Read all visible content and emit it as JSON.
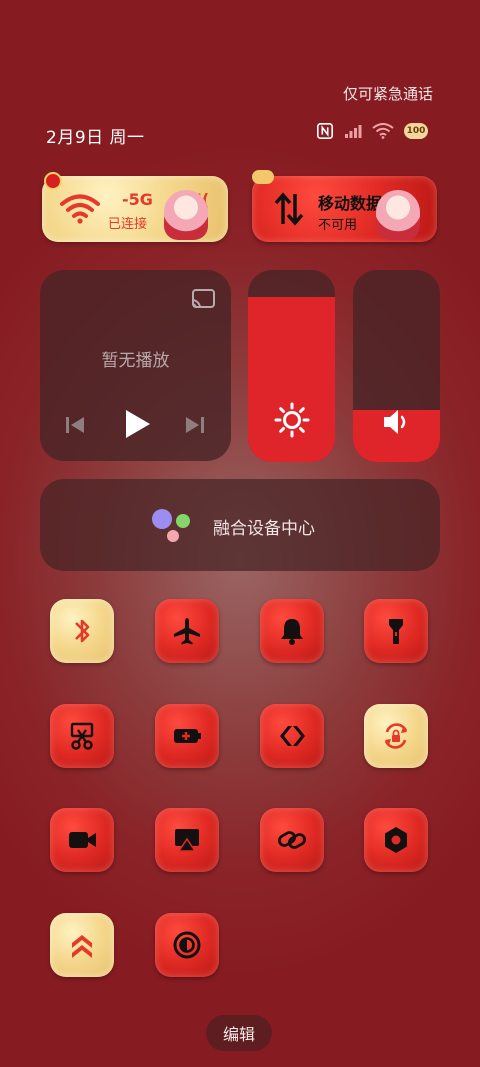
{
  "status": {
    "emergency_text": "仅可紧急通话",
    "date_text": "2月9日 周一",
    "battery": "100"
  },
  "wifi_card": {
    "title": "-5G",
    "extra": "MI(",
    "status": "已连接"
  },
  "data_card": {
    "title": "移动数据",
    "status": "不可用"
  },
  "media": {
    "status": "暂无播放"
  },
  "sliders": {
    "brightness_level": 0.86,
    "volume_level": 0.27
  },
  "device_center": {
    "label": "融合设备中心"
  },
  "toggles": [
    {
      "icon": "bluetooth-icon",
      "active": true
    },
    {
      "icon": "airplane-icon",
      "active": false
    },
    {
      "icon": "bell-icon",
      "active": false
    },
    {
      "icon": "flashlight-icon",
      "active": false
    },
    {
      "icon": "screenshot-scissors-icon",
      "active": false
    },
    {
      "icon": "battery-saver-icon",
      "active": false
    },
    {
      "icon": "share-arrow-icon",
      "active": false
    },
    {
      "icon": "rotation-lock-icon",
      "active": true
    },
    {
      "icon": "screen-record-icon",
      "active": false
    },
    {
      "icon": "cast-screen-icon",
      "active": false
    },
    {
      "icon": "link-icon",
      "active": false
    },
    {
      "icon": "hexagon-nut-icon",
      "active": false
    },
    {
      "icon": "performance-chevrons-icon",
      "active": true
    },
    {
      "icon": "dark-mode-icon",
      "active": false
    }
  ],
  "edit_label": "编辑",
  "colors": {
    "accent_red": "#e0252a",
    "fur_yellow": "#f5d98f",
    "background": "#8a2328"
  }
}
